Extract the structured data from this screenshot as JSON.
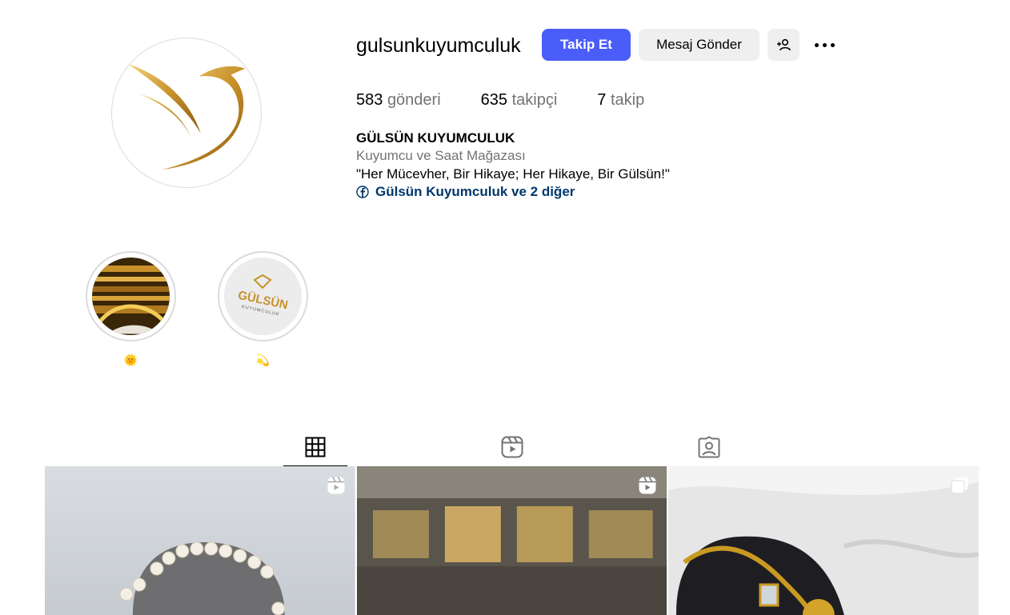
{
  "profile": {
    "username": "gulsunkuyumculuk",
    "follow_label": "Takip Et",
    "message_label": "Mesaj Gönder",
    "stats": [
      {
        "count": "583",
        "label": "gönderi"
      },
      {
        "count": "635",
        "label": "takipçi"
      },
      {
        "count": "7",
        "label": "takip"
      }
    ],
    "full_name": "GÜLSÜN KUYUMCULUK",
    "category": "Kuyumcu ve Saat Mağazası",
    "bio": "\"Her Mücevher, Bir Hikaye; Her Hikaye, Bir Gülsün!\"",
    "link_text": "Gülsün Kuyumculuk ve 2 diğer"
  },
  "highlights": [
    {
      "label": "🌞"
    },
    {
      "label": "💫"
    }
  ],
  "highlight_logo": {
    "brand": "GÜLSÜN",
    "sub": "KUYUMCULUK"
  },
  "tabs": [
    {
      "name": "posts-grid",
      "icon": "grid-icon"
    },
    {
      "name": "reels",
      "icon": "reels-icon"
    },
    {
      "name": "tagged",
      "icon": "tagged-icon"
    }
  ],
  "posts": [
    {
      "badge": "reels-icon"
    },
    {
      "badge": "reels-icon"
    },
    {
      "badge": "carousel-icon"
    }
  ],
  "colors": {
    "accent": "#4a5df9",
    "gold": "#c89a2c",
    "link": "#00376b",
    "muted": "#737373"
  }
}
